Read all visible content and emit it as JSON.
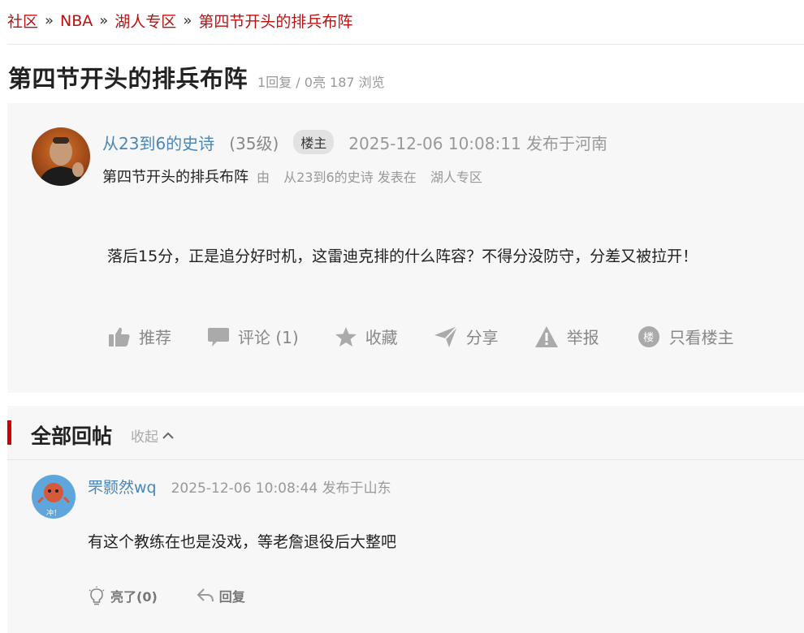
{
  "breadcrumb": {
    "items": [
      "社区",
      "NBA",
      "湖人专区",
      "第四节开头的排兵布阵"
    ],
    "separator": "»"
  },
  "thread": {
    "title": "第四节开头的排兵布阵",
    "stats": "1回复 / 0亮  187 浏览"
  },
  "post": {
    "author": "从23到6的史诗",
    "level": "(35级)",
    "badge": "楼主",
    "meta": "2025-12-06 10:08:11  发布于河南",
    "sub_title": "第四节开头的排兵布阵",
    "sub_by": "由",
    "sub_author": "从23到6的史诗 发表在",
    "sub_board": "湖人专区",
    "body": "落后15分，正是追分好时机，这雷迪克排的什么阵容？不得分没防守，分差又被拉开！",
    "actions": {
      "recommend": "推荐",
      "comment": "评论 (1)",
      "favorite": "收藏",
      "share": "分享",
      "report": "举报",
      "only_op_icon": "楼",
      "only_op": "只看楼主"
    }
  },
  "replies": {
    "title": "全部回帖",
    "collapse": "收起",
    "items": [
      {
        "author": "罘颢然wq",
        "meta": "2025-12-06 10:08:44  发布于山东",
        "avatar_text": "冲！",
        "text": "有这个教练在也是没戏，等老詹退役后大整吧",
        "light": "亮了(0)",
        "reply": "回复"
      }
    ]
  },
  "colors": {
    "brand_red": "#bb1111",
    "link_blue": "#4a86b8",
    "muted_gray": "#999999",
    "card_bg": "#f7f7f7"
  }
}
